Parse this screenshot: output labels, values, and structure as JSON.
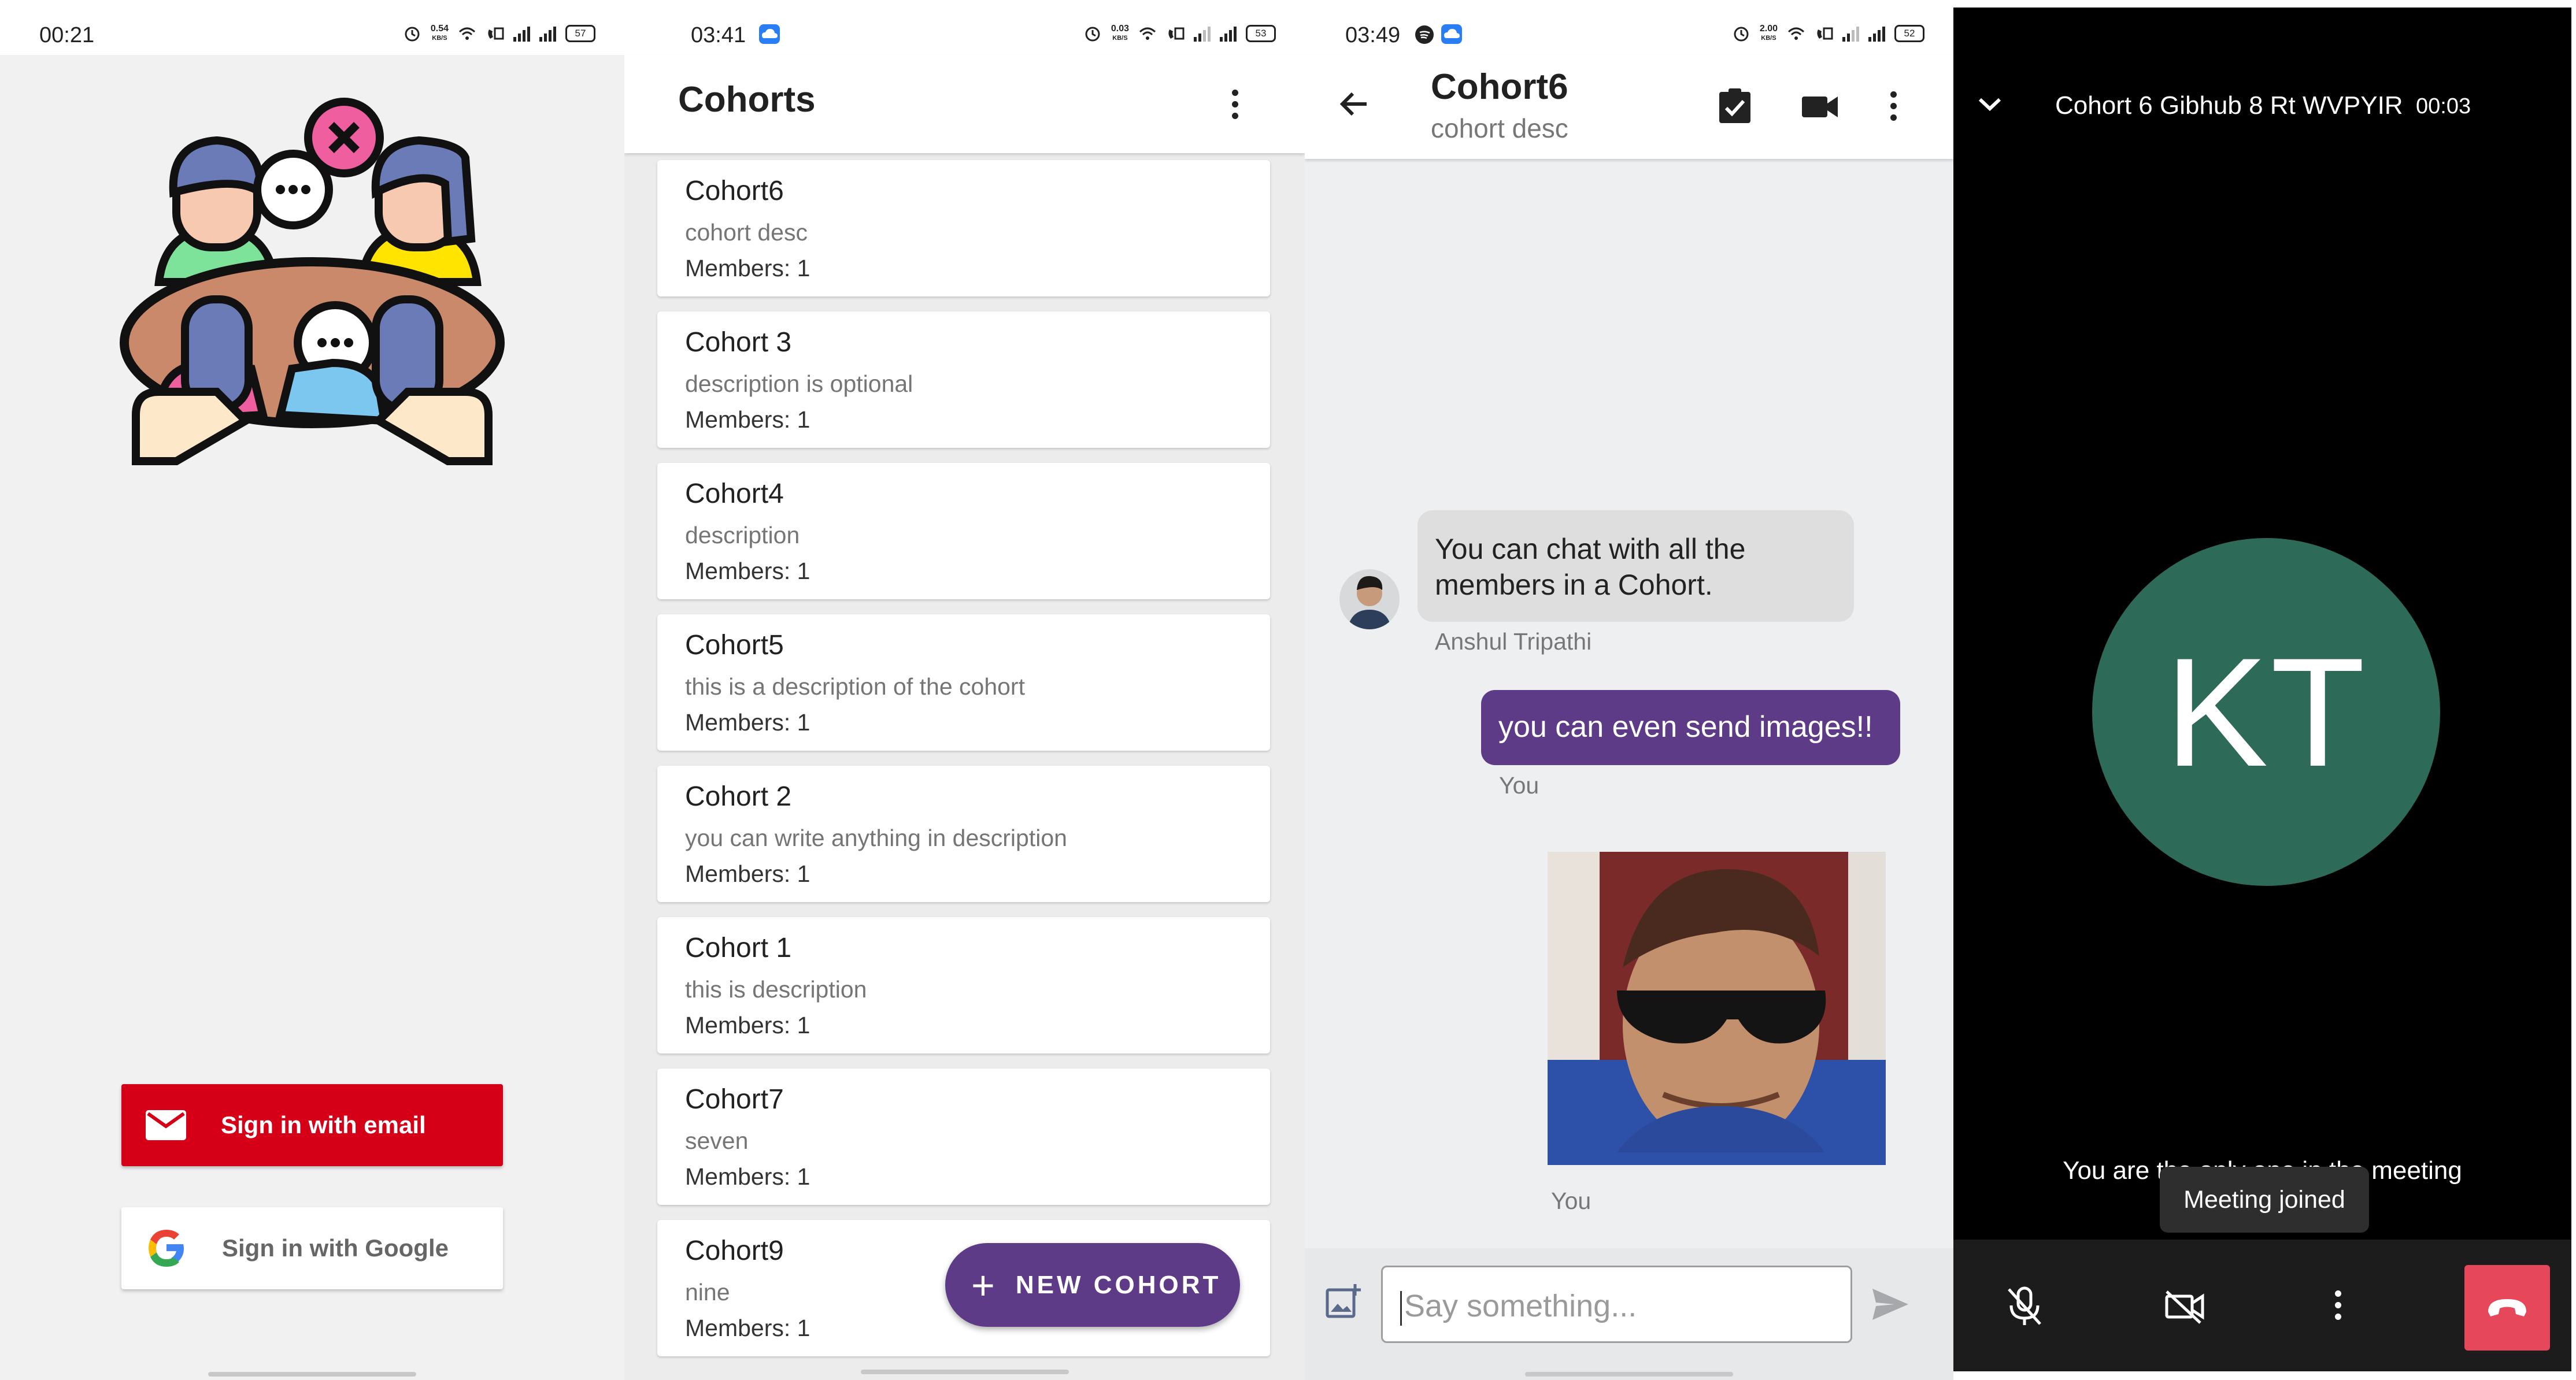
{
  "colors": {
    "brand_purple": "#5e3b87",
    "email_red": "#d50018",
    "avatar_green": "#2d6a57",
    "end_call_red": "#e6475a"
  },
  "screen1": {
    "status": {
      "time": "00:21",
      "speed": "0.54",
      "speed_unit": "KB/S",
      "battery": "57"
    },
    "illustration": "group-chat-illustration",
    "email_button": {
      "label": "Sign in with email",
      "icon": "mail-icon"
    },
    "google_button": {
      "label": "Sign in with Google",
      "icon": "google-g-icon"
    }
  },
  "screen2": {
    "status": {
      "time": "03:41",
      "speed": "0.03",
      "speed_unit": "KB/S",
      "battery": "53"
    },
    "title": "Cohorts",
    "cohorts": [
      {
        "name": "Cohort6",
        "desc": "cohort desc",
        "members": "Members: 1"
      },
      {
        "name": "Cohort 3",
        "desc": "description is optional",
        "members": "Members: 1"
      },
      {
        "name": "Cohort4",
        "desc": "description",
        "members": "Members: 1"
      },
      {
        "name": "Cohort5",
        "desc": "this is a description of the cohort",
        "members": "Members: 1"
      },
      {
        "name": "Cohort 2",
        "desc": "you can write anything in description",
        "members": "Members: 1"
      },
      {
        "name": "Cohort 1",
        "desc": "this is description",
        "members": "Members: 1"
      },
      {
        "name": "Cohort7",
        "desc": "seven",
        "members": "Members: 1"
      },
      {
        "name": "Cohort9",
        "desc": "nine",
        "members": "Members: 1"
      }
    ],
    "fab_label": "NEW COHORT"
  },
  "screen3": {
    "status": {
      "time": "03:49",
      "speed": "2.00",
      "speed_unit": "KB/S",
      "battery": "52"
    },
    "title": "Cohort6",
    "subtitle": "cohort desc",
    "messages": {
      "incoming_text": "You can chat with all the members in a Cohort.",
      "incoming_sender": "Anshul Tripathi",
      "outgoing_text": "you can even send images!!",
      "outgoing_sender": "You",
      "image_sender": "You"
    },
    "input_placeholder": "Say something..."
  },
  "screen4": {
    "meeting_title": "Cohort 6 Gibhub 8 Rt WVPYIR",
    "duration": "00:03",
    "initials": "KT",
    "alone_text": "You are the only one in the meeting",
    "toast": "Meeting joined"
  }
}
